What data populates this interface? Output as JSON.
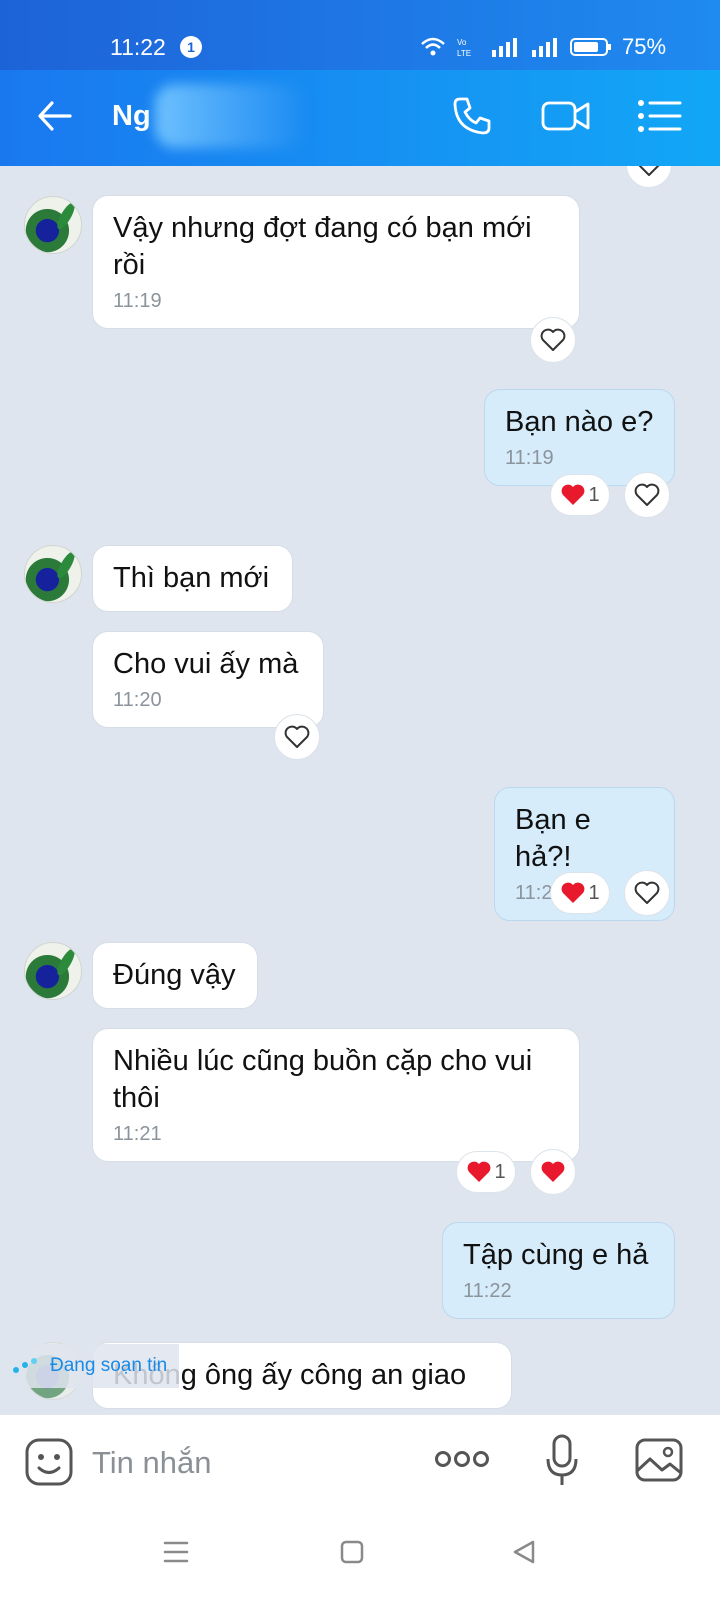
{
  "status_bar": {
    "time": "11:22",
    "notification_count": "1",
    "battery": "75%"
  },
  "header": {
    "contact_name": "Ng",
    "icons": [
      "back-arrow-icon",
      "phone-icon",
      "video-icon",
      "menu-list-icon"
    ]
  },
  "messages": [
    {
      "side": "in",
      "text": "Vậy nhưng đợt đang có bạn mới rồi",
      "time": "11:19"
    },
    {
      "side": "out",
      "text": "Bạn nào e?",
      "time": "11:19",
      "reaction_count": "1"
    },
    {
      "side": "in",
      "text": "Thì bạn mới"
    },
    {
      "side": "in",
      "text": "Cho vui ấy mà",
      "time": "11:20"
    },
    {
      "side": "out",
      "text": "Bạn e hả?!",
      "time": "11:21",
      "reaction_count": "1"
    },
    {
      "side": "in",
      "text": "Đúng vậy"
    },
    {
      "side": "in",
      "text": "Nhiều lúc cũng buồn cặp cho vui thôi",
      "time": "11:21",
      "reaction_count": "1"
    },
    {
      "side": "out",
      "text": "Tập cùng e hả",
      "time": "11:22"
    },
    {
      "side": "in",
      "text": "Không ông ấy công an giao"
    }
  ],
  "typing_indicator": "Đang soạn tin",
  "composer": {
    "placeholder": "Tin nhắn"
  },
  "colors": {
    "header": "#1a78ef",
    "outgoing_bubble": "#d6ecfb",
    "heart": "#e8192c",
    "background": "#dfe5ee"
  }
}
